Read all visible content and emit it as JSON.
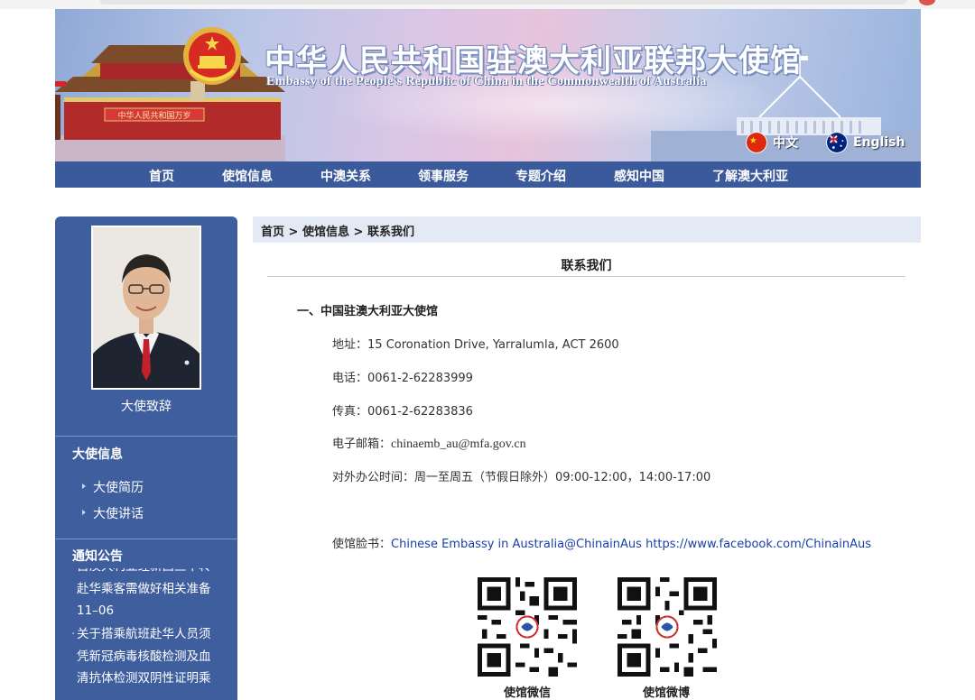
{
  "banner": {
    "title_cn": "中华人民共和国驻澳大利亚联邦大使馆",
    "title_en": "Embassy of the People's Republic of China in the Commonwealth of Australia",
    "gate_sign": "中华人民共和国万岁",
    "lang_cn": "中文",
    "lang_en": "English"
  },
  "nav": {
    "items": [
      "首页",
      "使馆信息",
      "中澳关系",
      "领事服务",
      "专题介绍",
      "感知中国",
      "了解澳大利亚"
    ]
  },
  "sidebar": {
    "photo_caption": "大使致辞",
    "section1": "大使信息",
    "links": [
      "大使简历",
      "大使讲话"
    ],
    "section2": "通知公告",
    "notices": [
      {
        "lines": [
          "自澳大利亚经新西兰中转",
          "赴华乘客需做好相关准备",
          "11–06"
        ]
      },
      {
        "lines": [
          "关于搭乘航班赴华人员须",
          "凭新冠病毒核酸检测及血",
          "清抗体检测双阴性证明乘"
        ]
      }
    ]
  },
  "breadcrumb": {
    "home": "首页",
    "sep": " > ",
    "section": "使馆信息",
    "current": "联系我们"
  },
  "content": {
    "title": "联系我们",
    "section_head": "一、中国驻澳大利亚大使馆",
    "address_label": "地址：",
    "address": "15 Coronation Drive, Yarralumla, ACT 2600",
    "phone_label": "电话：",
    "phone": "0061-2-62283999",
    "fax_label": "传真：",
    "fax": "0061-2-62283836",
    "email_label": "电子邮箱：",
    "email": "chinaemb_au@mfa.gov.cn",
    "hours_label": "对外办公时间：",
    "hours": "周一至周五（节假日除外）09:00-12:00，14:00-17:00",
    "facebook_label": "使馆脸书：",
    "facebook_name": "Chinese Embassy in Australia@ChinainAus",
    "facebook_url": "https://www.facebook.com/ChinainAus",
    "qr_wechat_label": "使馆微信",
    "qr_weibo_label": "使馆微博"
  },
  "colors": {
    "nav_bg": "#3a5a9c",
    "sidebar_bg": "#3e5e9e",
    "crumb_bg": "#e3e9f5",
    "link": "#1a3fa8"
  }
}
